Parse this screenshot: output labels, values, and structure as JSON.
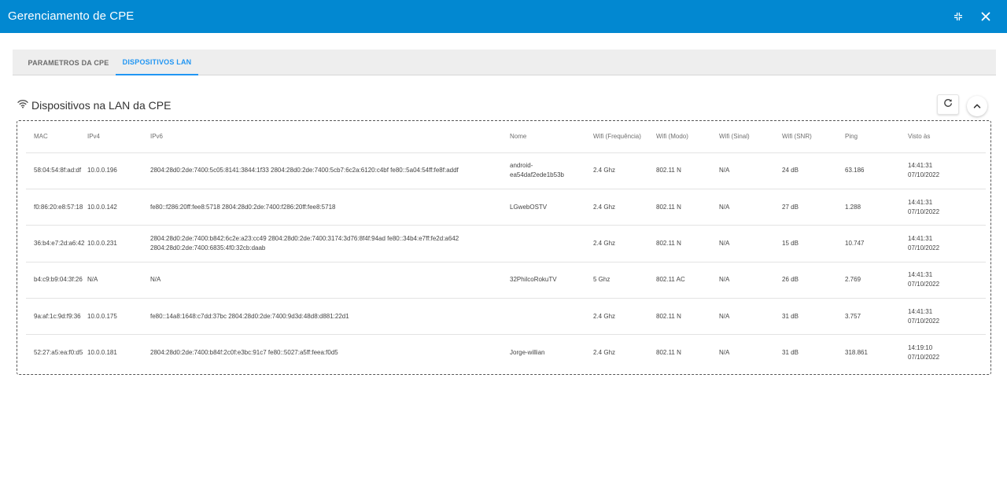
{
  "window": {
    "title": "Gerenciamento de CPE",
    "controls": [
      "collapse-arrows-icon",
      "close-icon"
    ]
  },
  "tabs": [
    {
      "label": "PARAMETROS DA CPE",
      "active": false
    },
    {
      "label": "DISPOSITIVOS LAN",
      "active": true
    }
  ],
  "section": {
    "icon": "wifi-icon",
    "title": "Dispositivos na LAN da CPE",
    "actions": [
      "refresh-icon",
      "chevron-up-icon"
    ]
  },
  "table": {
    "columns": [
      "MAC",
      "IPv4",
      "IPv6",
      "Nome",
      "Wifi (Frequência)",
      "Wifi (Modo)",
      "Wifi (Sinal)",
      "Wifi (SNR)",
      "Ping",
      "Visto às"
    ],
    "rows": [
      {
        "mac": "58:04:54:8f:ad:df",
        "ipv4": "10.0.0.196",
        "ipv6": "2804:28d0:2de:7400:5c05:8141:3844:1f33 2804:28d0:2de:7400:5cb7:6c2a:6120:c4bf fe80::5a04:54ff:fe8f:addf",
        "nome": "android-ea54daf2ede1b53b",
        "freq": "2.4 Ghz",
        "modo": "802.11 N",
        "sinal": "N/A",
        "snr": "24 dB",
        "ping": "63.186",
        "visto_time": "14:41:31",
        "visto_date": "07/10/2022"
      },
      {
        "mac": "f0:86:20:e8:57:18",
        "ipv4": "10.0.0.142",
        "ipv6": "fe80::f286:20ff:fee8:5718 2804:28d0:2de:7400:f286:20ff:fee8:5718",
        "nome": "LGwebOSTV",
        "freq": "2.4 Ghz",
        "modo": "802.11 N",
        "sinal": "N/A",
        "snr": "27 dB",
        "ping": "1.288",
        "visto_time": "14:41:31",
        "visto_date": "07/10/2022"
      },
      {
        "mac": "36:b4:e7:2d:a6:42",
        "ipv4": "10.0.0.231",
        "ipv6": "2804:28d0:2de:7400:b842:6c2e:a23:cc49 2804:28d0:2de:7400:3174:3d76:8f4f:94ad fe80::34b4:e7ff:fe2d:a642 2804:28d0:2de:7400:6835:4f0:32cb:daab",
        "nome": "",
        "freq": "2.4 Ghz",
        "modo": "802.11 N",
        "sinal": "N/A",
        "snr": "15 dB",
        "ping": "10.747",
        "visto_time": "14:41:31",
        "visto_date": "07/10/2022"
      },
      {
        "mac": "b4:c9:b9:04:3f:26",
        "ipv4": "N/A",
        "ipv6": "N/A",
        "nome": "32PhilcoRokuTV",
        "freq": "5 Ghz",
        "modo": "802.11 AC",
        "sinal": "N/A",
        "snr": "26 dB",
        "ping": "2.769",
        "visto_time": "14:41:31",
        "visto_date": "07/10/2022"
      },
      {
        "mac": "9a:af:1c:9d:f9:36",
        "ipv4": "10.0.0.175",
        "ipv6": "fe80::14a8:1648:c7dd:37bc 2804:28d0:2de:7400:9d3d:48d8:d881:22d1",
        "nome": "",
        "freq": "2.4 Ghz",
        "modo": "802.11 N",
        "sinal": "N/A",
        "snr": "31 dB",
        "ping": "3.757",
        "visto_time": "14:41:31",
        "visto_date": "07/10/2022"
      },
      {
        "mac": "52:27:a5:ea:f0:d5",
        "ipv4": "10.0.0.181",
        "ipv6": "2804:28d0:2de:7400:b84f:2c0f:e3bc:91c7 fe80::5027:a5ff:feea:f0d5",
        "nome": "Jorge-willian",
        "freq": "2.4 Ghz",
        "modo": "802.11 N",
        "sinal": "N/A",
        "snr": "31 dB",
        "ping": "318.861",
        "visto_time": "14:19:10",
        "visto_date": "07/10/2022"
      }
    ]
  },
  "colors": {
    "titlebar": "#0288d1",
    "accent": "#2196f3",
    "tab_bar": "#eeeeee"
  }
}
